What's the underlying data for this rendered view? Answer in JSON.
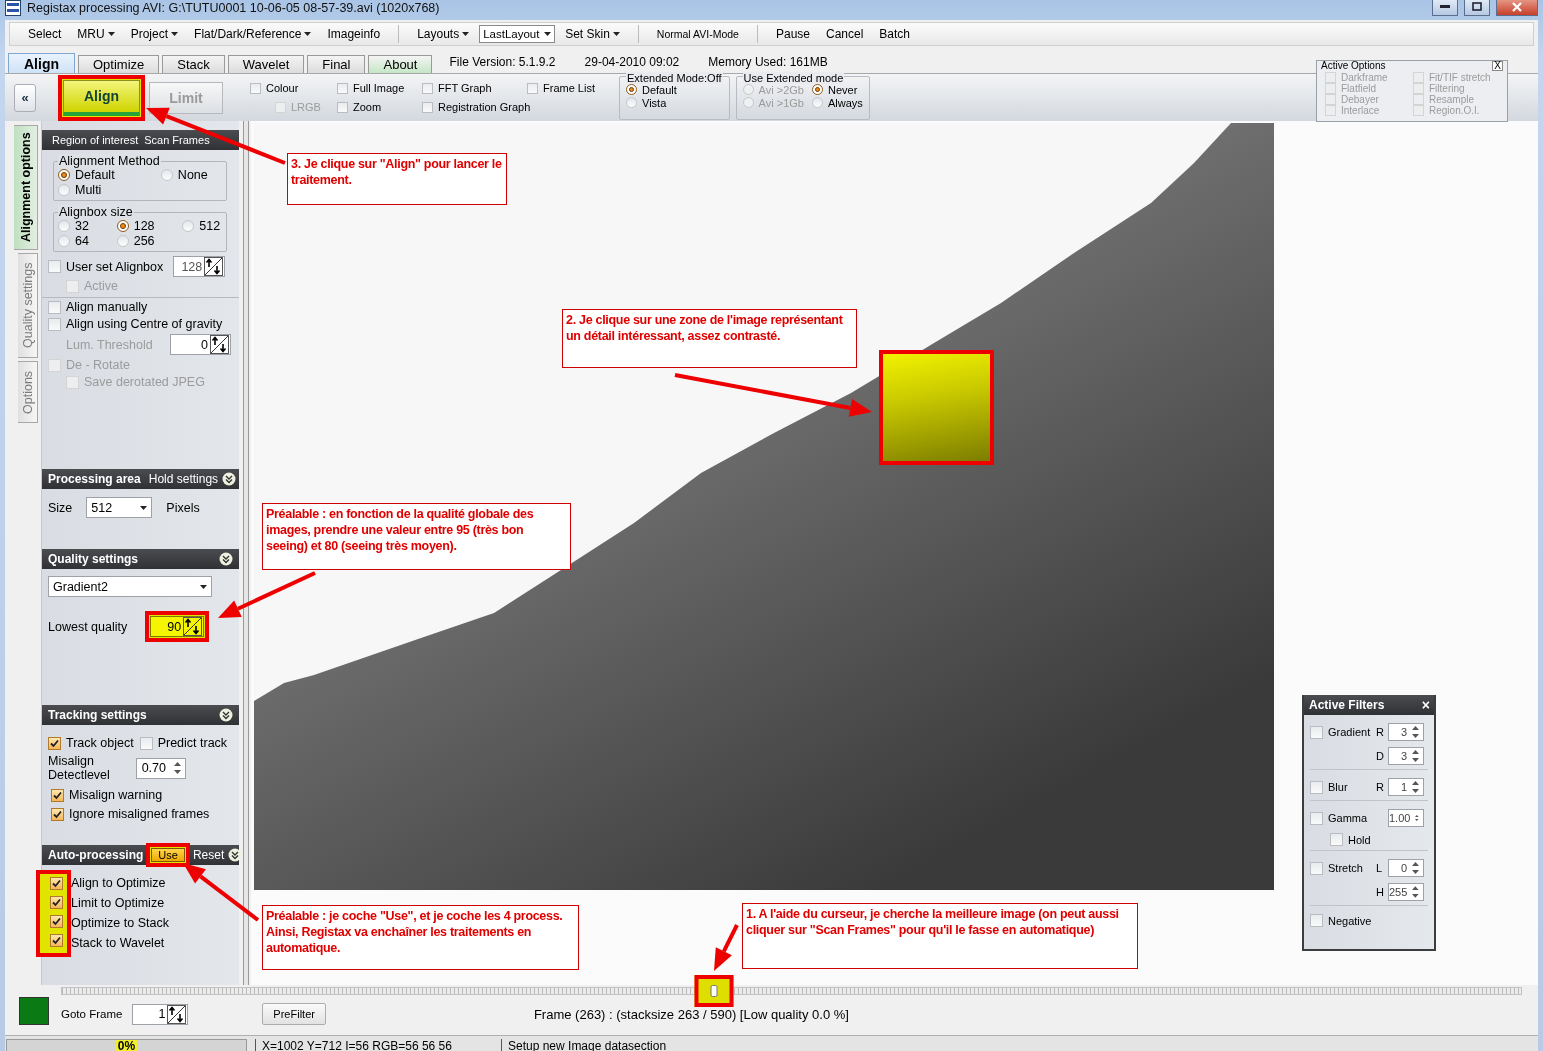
{
  "window": {
    "title": "Registax processing AVI: G:\\TUTU0001 10-06-05 08-57-39.avi (1020x768)"
  },
  "menu": [
    {
      "kind": "item",
      "label": "Select"
    },
    {
      "kind": "dropdown",
      "label": "MRU"
    },
    {
      "kind": "dropdown",
      "label": "Project"
    },
    {
      "kind": "dropdown",
      "label": "Flat/Dark/Reference"
    },
    {
      "kind": "item",
      "label": "Imageinfo"
    },
    {
      "kind": "separator"
    },
    {
      "kind": "dropdown",
      "label": "Layouts"
    },
    {
      "kind": "select",
      "value": "LastLayout"
    },
    {
      "kind": "dropdown",
      "label": "Set Skin"
    },
    {
      "kind": "separator"
    },
    {
      "kind": "mode",
      "label": "Normal AVI-Mode"
    },
    {
      "kind": "separator"
    },
    {
      "kind": "item",
      "label": "Pause"
    },
    {
      "kind": "item",
      "label": "Cancel"
    },
    {
      "kind": "item",
      "label": "Batch"
    }
  ],
  "tabs": [
    {
      "label": "Align",
      "selected": true,
      "color": "#cfe2f6"
    },
    {
      "label": "Optimize",
      "selected": false,
      "color": "#dcdcdc"
    },
    {
      "label": "Stack",
      "selected": false,
      "color": "#dcdcdc"
    },
    {
      "label": "Wavelet",
      "selected": false,
      "color": "#dcdcdc"
    },
    {
      "label": "Final",
      "selected": false,
      "color": "#dcdcdc"
    },
    {
      "label": "About",
      "selected": false,
      "color": "#c6e6c6"
    }
  ],
  "file_info": [
    "File Version: 5.1.9.2",
    "29-04-2010 09:02",
    "Memory Used: 161MB"
  ],
  "toolbar": {
    "collapse": "«",
    "actions": [
      {
        "label": "Align",
        "disabled": false,
        "highlighted": true
      },
      {
        "label": "Limit",
        "disabled": true,
        "highlighted": false
      }
    ],
    "view_options": [
      [
        {
          "label": "Colour",
          "checked": false,
          "disabled": false
        },
        {
          "label": "LRGB",
          "checked": false,
          "disabled": true
        }
      ],
      [
        {
          "label": "Full Image",
          "checked": false,
          "disabled": false
        },
        {
          "label": "Zoom",
          "checked": false,
          "disabled": false
        }
      ],
      [
        {
          "label": "FFT Graph",
          "checked": false,
          "disabled": false
        },
        {
          "label": "Registration Graph",
          "checked": false,
          "disabled": false
        }
      ],
      [
        {
          "label": "Frame List",
          "checked": false,
          "disabled": false
        }
      ]
    ],
    "mode_groups": [
      {
        "title": "Extended Mode:Off",
        "options": [
          {
            "label": "Default",
            "selected": true,
            "disabled": false
          },
          {
            "label": "Vista",
            "selected": false,
            "disabled": false
          }
        ]
      },
      {
        "title": "Use  Extended mode",
        "options": [
          {
            "label": "Avi >2Gb",
            "selected": false,
            "disabled": true
          },
          {
            "label": "Never",
            "selected": true,
            "disabled": false
          },
          {
            "label": "Avi >1Gb",
            "selected": false,
            "disabled": true
          },
          {
            "label": "Always",
            "selected": false,
            "disabled": false
          }
        ]
      }
    ]
  },
  "active_options": {
    "title": "Active Options",
    "close": "X",
    "items": [
      {
        "label": "Darkframe",
        "checked": false
      },
      {
        "label": "Fit/TIF stretch",
        "checked": false
      },
      {
        "label": "Flatfield",
        "checked": false
      },
      {
        "label": "Filtering",
        "checked": false
      },
      {
        "label": "Debayer",
        "checked": false
      },
      {
        "label": "Resample",
        "checked": false
      },
      {
        "label": "Interlace",
        "checked": false
      },
      {
        "label": "Region.O.I.",
        "checked": false
      }
    ]
  },
  "side_tabs": [
    {
      "label": "Alignment options",
      "selected": true
    },
    {
      "label": "Quality settings",
      "selected": false
    },
    {
      "label": "Options",
      "selected": false
    }
  ],
  "alignment": {
    "header": [
      "Region of interest",
      "Scan Frames"
    ],
    "groups": [
      {
        "title": "Alignment Method",
        "options": [
          {
            "label": "Default",
            "selected": true
          },
          {
            "label": "None",
            "selected": false
          },
          {
            "label": "Multi",
            "selected": false
          }
        ]
      },
      {
        "title": "Alignbox size",
        "options": [
          {
            "label": "32",
            "selected": false
          },
          {
            "label": "128",
            "selected": true
          },
          {
            "label": "512",
            "selected": false
          },
          {
            "label": "64",
            "selected": false
          },
          {
            "label": "256",
            "selected": false
          }
        ]
      }
    ],
    "user_alignbox": {
      "label": "User set Alignbox",
      "checked": false,
      "disabled": false,
      "value": "128",
      "children": [
        {
          "label": "Active",
          "checked": false,
          "disabled": true
        }
      ]
    },
    "extras": [
      {
        "kind": "check",
        "label": "Align manually",
        "checked": false,
        "disabled": false
      },
      {
        "kind": "check",
        "label": "Align using Centre of gravity",
        "checked": false,
        "disabled": false,
        "children": [
          {
            "kind": "spin",
            "label": "Lum. Threshold",
            "value": "0",
            "disabled": true
          }
        ]
      },
      {
        "kind": "check",
        "label": "De - Rotate",
        "checked": false,
        "disabled": true,
        "children": [
          {
            "kind": "check",
            "label": "Save derotated JPEG",
            "checked": false,
            "disabled": true
          }
        ]
      }
    ]
  },
  "processing_area": {
    "title": "Processing area",
    "action": "Hold settings",
    "label": "Size",
    "value": "512",
    "unit": "Pixels"
  },
  "quality": {
    "title": "Quality settings",
    "method": "Gradient2",
    "label": "Lowest quality",
    "value": "90",
    "highlighted": true
  },
  "tracking": {
    "title": "Tracking settings",
    "options": [
      {
        "label": "Track object",
        "checked": true
      },
      {
        "label": "Predict track",
        "checked": false
      }
    ],
    "detect_label": "Misalign Detectlevel",
    "detect_value": "0.70",
    "checks": [
      {
        "label": "Misalign warning",
        "checked": true
      },
      {
        "label": "Ignore misaligned frames",
        "checked": true
      }
    ]
  },
  "auto_processing": {
    "title": "Auto-processing",
    "use": {
      "label": "Use",
      "highlighted": true
    },
    "reset": "Reset",
    "highlighted": true,
    "steps": [
      {
        "label": "Align to Optimize",
        "checked": true
      },
      {
        "label": "Limit to Optimize",
        "checked": true
      },
      {
        "label": "Optimize to Stack",
        "checked": true
      },
      {
        "label": "Stack to Wavelet",
        "checked": true
      }
    ]
  },
  "image": {
    "selection": true
  },
  "active_filters": {
    "title": "Active Filters",
    "close": "×",
    "filters": [
      {
        "label": "Gradient",
        "checked": false,
        "params": [
          {
            "label": "R",
            "value": "3"
          },
          {
            "label": "D",
            "value": "3"
          }
        ]
      },
      {
        "label": "Blur",
        "checked": false,
        "params": [
          {
            "label": "R",
            "value": "1"
          }
        ]
      },
      {
        "label": "Gamma",
        "checked": false,
        "params": [
          {
            "value": "1.00"
          }
        ],
        "options": [
          {
            "label": "Hold",
            "checked": false
          }
        ]
      },
      {
        "label": "Stretch",
        "checked": false,
        "params": [
          {
            "label": "L",
            "value": "0"
          },
          {
            "label": "H",
            "value": "255"
          }
        ]
      },
      {
        "label": "Negative",
        "checked": false
      }
    ]
  },
  "frame_slider": {
    "level": 0.447,
    "highlighted": true
  },
  "bottom": {
    "color": "#0a7a14",
    "goto_label": "Goto Frame",
    "goto_value": "1",
    "prefilter": "PreFilter",
    "frame_text": "Frame (263) :  (stacksize 263 / 590) [Low quality 0.0 %]"
  },
  "status_bar": {
    "progress": {
      "level": 0,
      "label": "0%"
    },
    "fields": [
      "X=1002 Y=712 I=56 RGB=56 56 56",
      "Setup new Image datasection"
    ]
  },
  "annotations": [
    {
      "text": "3. Je clique sur \"Align\" pour lancer le traitement."
    },
    {
      "text": "2. Je clique sur une zone de l'image représentant un détail intéressant, assez contrasté."
    },
    {
      "text": "Préalable : en fonction de la qualité globale des images, prendre une valeur entre 95 (très bon seeing) et 80 (seeing très moyen)."
    },
    {
      "text": "Préalable : je coche \"Use\", et je coche les 4 process. Ainsi, Registax va enchaîner les traitements en automatique."
    },
    {
      "text": "1. A l'aide du curseur, je cherche la meilleure image (on peut aussi cliquer sur \"Scan Frames\" pour qu'il le fasse en automatique)"
    }
  ]
}
